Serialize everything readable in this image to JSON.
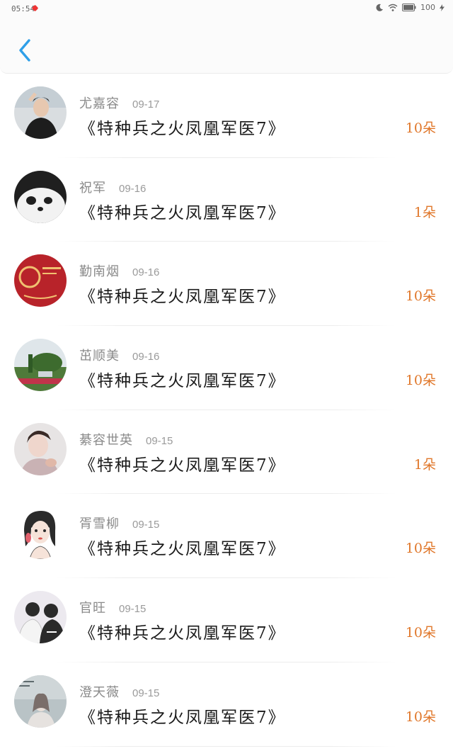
{
  "status_bar": {
    "time": "05:54",
    "battery": "100"
  },
  "header": {
    "back_icon": "chevron-left-icon",
    "accent_color": "#2f9fe8"
  },
  "gift_color": "#e0772a",
  "records": [
    {
      "name": "尤嘉容",
      "date": "09-17",
      "title": "《特种兵之火凤凰军医7》",
      "amount": "10朵"
    },
    {
      "name": "祝军",
      "date": "09-16",
      "title": "《特种兵之火凤凰军医7》",
      "amount": "1朵"
    },
    {
      "name": "勤南烟",
      "date": "09-16",
      "title": "《特种兵之火凤凰军医7》",
      "amount": "10朵"
    },
    {
      "name": "茁顺美",
      "date": "09-16",
      "title": "《特种兵之火凤凰军医7》",
      "amount": "10朵"
    },
    {
      "name": "綦容世英",
      "date": "09-15",
      "title": "《特种兵之火凤凰军医7》",
      "amount": "1朵"
    },
    {
      "name": "胥雪柳",
      "date": "09-15",
      "title": "《特种兵之火凤凰军医7》",
      "amount": "10朵"
    },
    {
      "name": "官旺",
      "date": "09-15",
      "title": "《特种兵之火凤凰军医7》",
      "amount": "10朵"
    },
    {
      "name": "澄天薇",
      "date": "09-15",
      "title": "《特种兵之火凤凰军医7》",
      "amount": "10朵"
    }
  ]
}
